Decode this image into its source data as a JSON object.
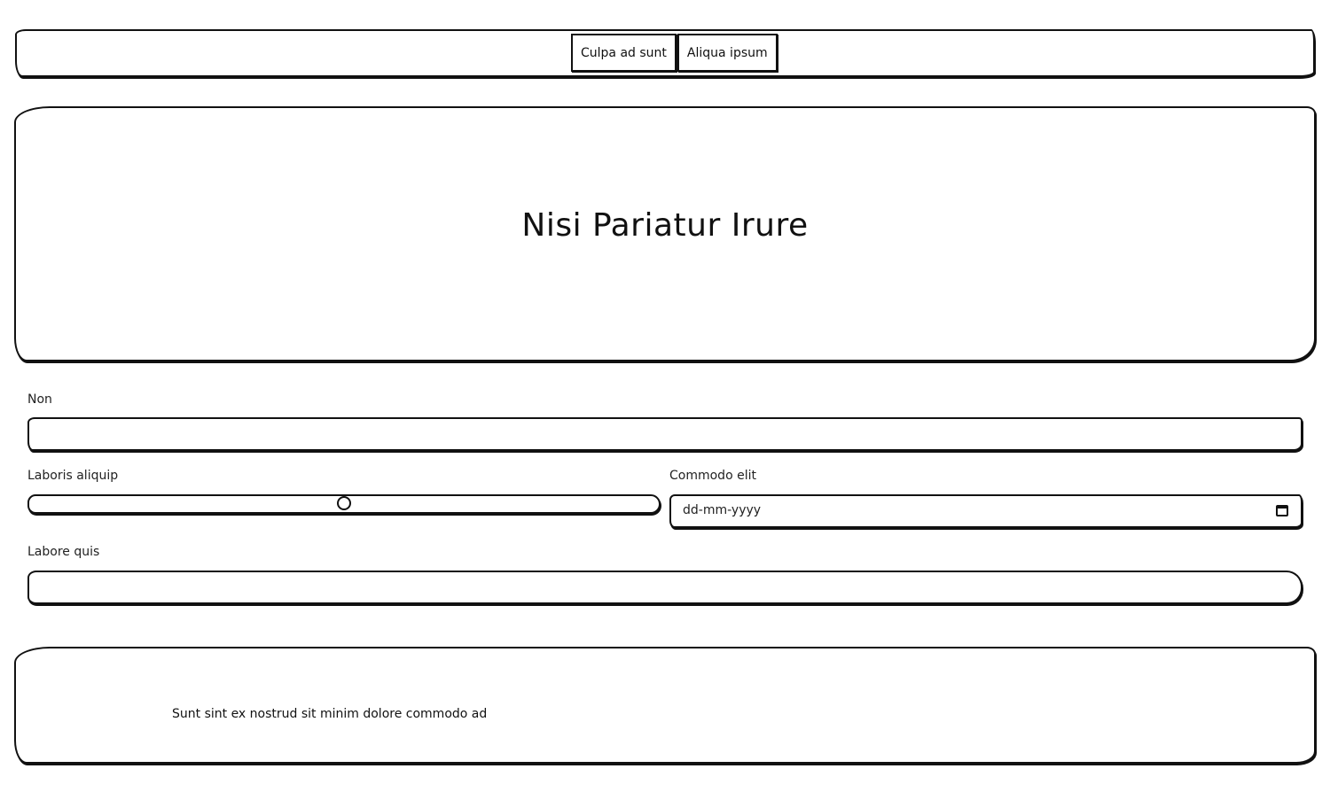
{
  "nav": {
    "buttons": [
      "Culpa ad sunt",
      "Aliqua ipsum"
    ]
  },
  "hero": {
    "title": "Nisi Pariatur Irure"
  },
  "form": {
    "non_label": "Non",
    "non_value": "",
    "laboris_label": "Laboris aliquip",
    "laboris_slider_level_percent": 50,
    "commodo_label": "Commodo elit",
    "commodo_placeholder": "dd-mm-yyyy",
    "labore_label": "Labore quis",
    "labore_value": ""
  },
  "footer": {
    "text": "Sunt sint ex nostrud sit minim dolore commodo ad"
  },
  "icons": {
    "date": "calendar-icon"
  }
}
